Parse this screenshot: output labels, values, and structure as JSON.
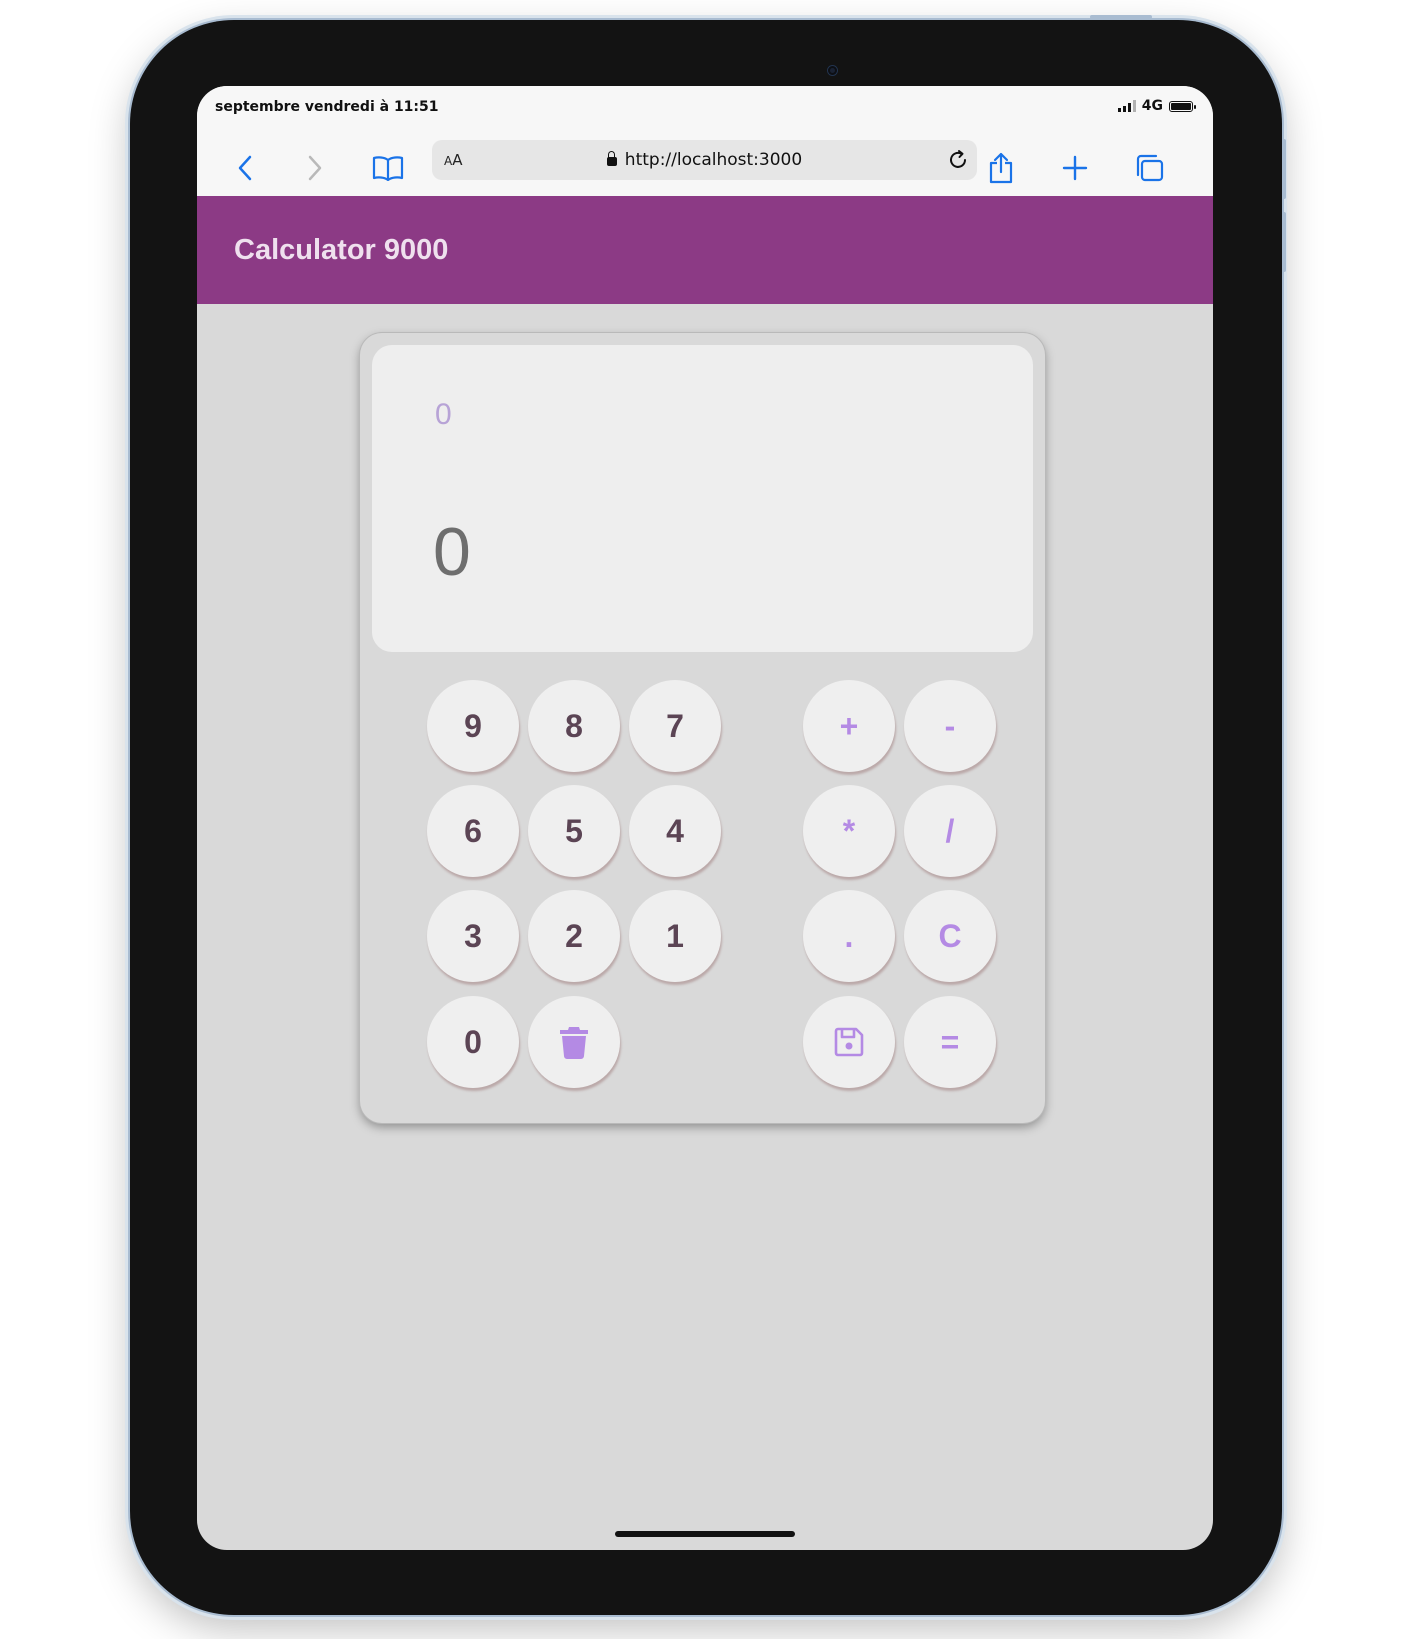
{
  "status_bar": {
    "time": "septembre vendredi à 11:51",
    "network": "4G"
  },
  "browser": {
    "aa_label_small": "A",
    "aa_label_big": "A",
    "url": "http://localhost:3000",
    "icons": [
      "chevron-left-icon",
      "chevron-right-icon",
      "book-icon",
      "lock-icon",
      "reload-icon",
      "share-icon",
      "plus-icon",
      "tabs-icon"
    ]
  },
  "app": {
    "title": "Calculator 9000",
    "header_color": "#8c3a85"
  },
  "display": {
    "previous": "0",
    "current": "0"
  },
  "keys": {
    "k9": "9",
    "k8": "8",
    "k7": "7",
    "k6": "6",
    "k5": "5",
    "k4": "4",
    "k3": "3",
    "k2": "2",
    "k1": "1",
    "k0": "0",
    "plus": "+",
    "minus": "-",
    "multiply": "*",
    "divide": "/",
    "dot": ".",
    "clear": "C",
    "equals": "=",
    "delete_icon": "trash-icon",
    "save_icon": "floppy-disk-icon"
  },
  "colors": {
    "digit": "#5b4454",
    "operator": "#b48ae4",
    "accent": "#8c3a85"
  }
}
